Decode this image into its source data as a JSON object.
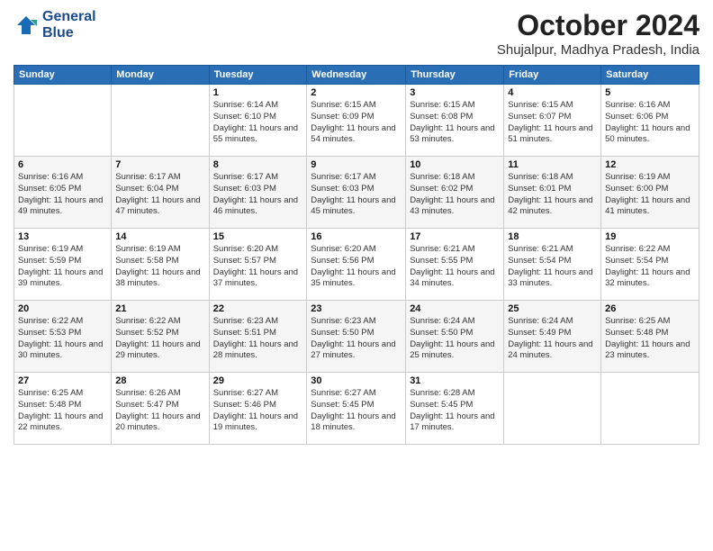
{
  "logo": {
    "line1": "General",
    "line2": "Blue"
  },
  "title": "October 2024",
  "location": "Shujalpur, Madhya Pradesh, India",
  "weekdays": [
    "Sunday",
    "Monday",
    "Tuesday",
    "Wednesday",
    "Thursday",
    "Friday",
    "Saturday"
  ],
  "weeks": [
    [
      {
        "day": "",
        "info": ""
      },
      {
        "day": "",
        "info": ""
      },
      {
        "day": "1",
        "info": "Sunrise: 6:14 AM\nSunset: 6:10 PM\nDaylight: 11 hours and 55 minutes."
      },
      {
        "day": "2",
        "info": "Sunrise: 6:15 AM\nSunset: 6:09 PM\nDaylight: 11 hours and 54 minutes."
      },
      {
        "day": "3",
        "info": "Sunrise: 6:15 AM\nSunset: 6:08 PM\nDaylight: 11 hours and 53 minutes."
      },
      {
        "day": "4",
        "info": "Sunrise: 6:15 AM\nSunset: 6:07 PM\nDaylight: 11 hours and 51 minutes."
      },
      {
        "day": "5",
        "info": "Sunrise: 6:16 AM\nSunset: 6:06 PM\nDaylight: 11 hours and 50 minutes."
      }
    ],
    [
      {
        "day": "6",
        "info": "Sunrise: 6:16 AM\nSunset: 6:05 PM\nDaylight: 11 hours and 49 minutes."
      },
      {
        "day": "7",
        "info": "Sunrise: 6:17 AM\nSunset: 6:04 PM\nDaylight: 11 hours and 47 minutes."
      },
      {
        "day": "8",
        "info": "Sunrise: 6:17 AM\nSunset: 6:03 PM\nDaylight: 11 hours and 46 minutes."
      },
      {
        "day": "9",
        "info": "Sunrise: 6:17 AM\nSunset: 6:03 PM\nDaylight: 11 hours and 45 minutes."
      },
      {
        "day": "10",
        "info": "Sunrise: 6:18 AM\nSunset: 6:02 PM\nDaylight: 11 hours and 43 minutes."
      },
      {
        "day": "11",
        "info": "Sunrise: 6:18 AM\nSunset: 6:01 PM\nDaylight: 11 hours and 42 minutes."
      },
      {
        "day": "12",
        "info": "Sunrise: 6:19 AM\nSunset: 6:00 PM\nDaylight: 11 hours and 41 minutes."
      }
    ],
    [
      {
        "day": "13",
        "info": "Sunrise: 6:19 AM\nSunset: 5:59 PM\nDaylight: 11 hours and 39 minutes."
      },
      {
        "day": "14",
        "info": "Sunrise: 6:19 AM\nSunset: 5:58 PM\nDaylight: 11 hours and 38 minutes."
      },
      {
        "day": "15",
        "info": "Sunrise: 6:20 AM\nSunset: 5:57 PM\nDaylight: 11 hours and 37 minutes."
      },
      {
        "day": "16",
        "info": "Sunrise: 6:20 AM\nSunset: 5:56 PM\nDaylight: 11 hours and 35 minutes."
      },
      {
        "day": "17",
        "info": "Sunrise: 6:21 AM\nSunset: 5:55 PM\nDaylight: 11 hours and 34 minutes."
      },
      {
        "day": "18",
        "info": "Sunrise: 6:21 AM\nSunset: 5:54 PM\nDaylight: 11 hours and 33 minutes."
      },
      {
        "day": "19",
        "info": "Sunrise: 6:22 AM\nSunset: 5:54 PM\nDaylight: 11 hours and 32 minutes."
      }
    ],
    [
      {
        "day": "20",
        "info": "Sunrise: 6:22 AM\nSunset: 5:53 PM\nDaylight: 11 hours and 30 minutes."
      },
      {
        "day": "21",
        "info": "Sunrise: 6:22 AM\nSunset: 5:52 PM\nDaylight: 11 hours and 29 minutes."
      },
      {
        "day": "22",
        "info": "Sunrise: 6:23 AM\nSunset: 5:51 PM\nDaylight: 11 hours and 28 minutes."
      },
      {
        "day": "23",
        "info": "Sunrise: 6:23 AM\nSunset: 5:50 PM\nDaylight: 11 hours and 27 minutes."
      },
      {
        "day": "24",
        "info": "Sunrise: 6:24 AM\nSunset: 5:50 PM\nDaylight: 11 hours and 25 minutes."
      },
      {
        "day": "25",
        "info": "Sunrise: 6:24 AM\nSunset: 5:49 PM\nDaylight: 11 hours and 24 minutes."
      },
      {
        "day": "26",
        "info": "Sunrise: 6:25 AM\nSunset: 5:48 PM\nDaylight: 11 hours and 23 minutes."
      }
    ],
    [
      {
        "day": "27",
        "info": "Sunrise: 6:25 AM\nSunset: 5:48 PM\nDaylight: 11 hours and 22 minutes."
      },
      {
        "day": "28",
        "info": "Sunrise: 6:26 AM\nSunset: 5:47 PM\nDaylight: 11 hours and 20 minutes."
      },
      {
        "day": "29",
        "info": "Sunrise: 6:27 AM\nSunset: 5:46 PM\nDaylight: 11 hours and 19 minutes."
      },
      {
        "day": "30",
        "info": "Sunrise: 6:27 AM\nSunset: 5:45 PM\nDaylight: 11 hours and 18 minutes."
      },
      {
        "day": "31",
        "info": "Sunrise: 6:28 AM\nSunset: 5:45 PM\nDaylight: 11 hours and 17 minutes."
      },
      {
        "day": "",
        "info": ""
      },
      {
        "day": "",
        "info": ""
      }
    ]
  ]
}
